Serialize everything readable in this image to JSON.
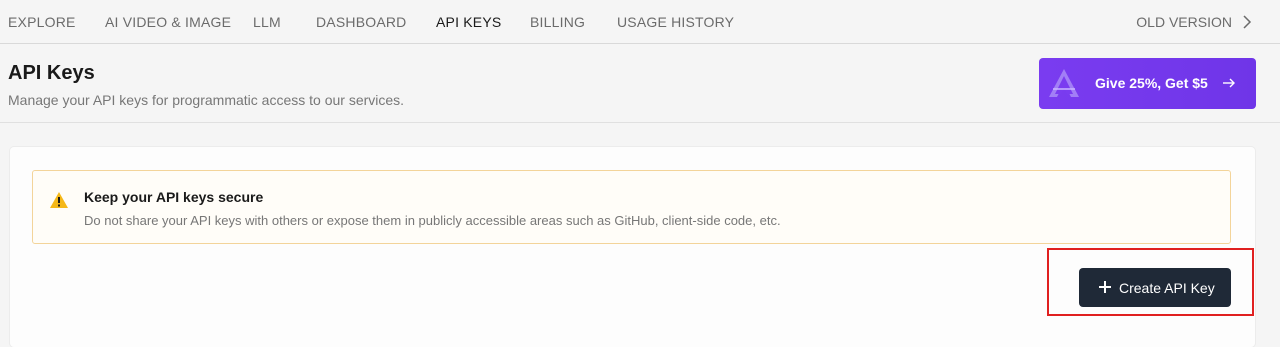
{
  "nav": {
    "tabs": [
      {
        "label": "EXPLORE"
      },
      {
        "label": "AI VIDEO & IMAGE"
      },
      {
        "label": "LLM"
      },
      {
        "label": "DASHBOARD"
      },
      {
        "label": "API KEYS"
      },
      {
        "label": "BILLING"
      },
      {
        "label": "USAGE HISTORY"
      }
    ],
    "active_tab": "API KEYS",
    "old_version": "OLD VERSION"
  },
  "header": {
    "title": "API Keys",
    "subtitle": "Manage your API keys for programmatic access to our services."
  },
  "promo": {
    "label": "Give 25%, Get $5",
    "color": "#7a3cf0"
  },
  "alert": {
    "icon": "warning-icon",
    "title": "Keep your API keys secure",
    "description": "Do not share your API keys with others or expose them in publicly accessible areas such as GitHub, client-side code, etc."
  },
  "actions": {
    "create_label": "Create API Key",
    "create_icon": "plus-icon"
  },
  "colors": {
    "highlight": "#e02020",
    "primary_button": "#1f2937",
    "alert_border": "#f3d49a"
  }
}
